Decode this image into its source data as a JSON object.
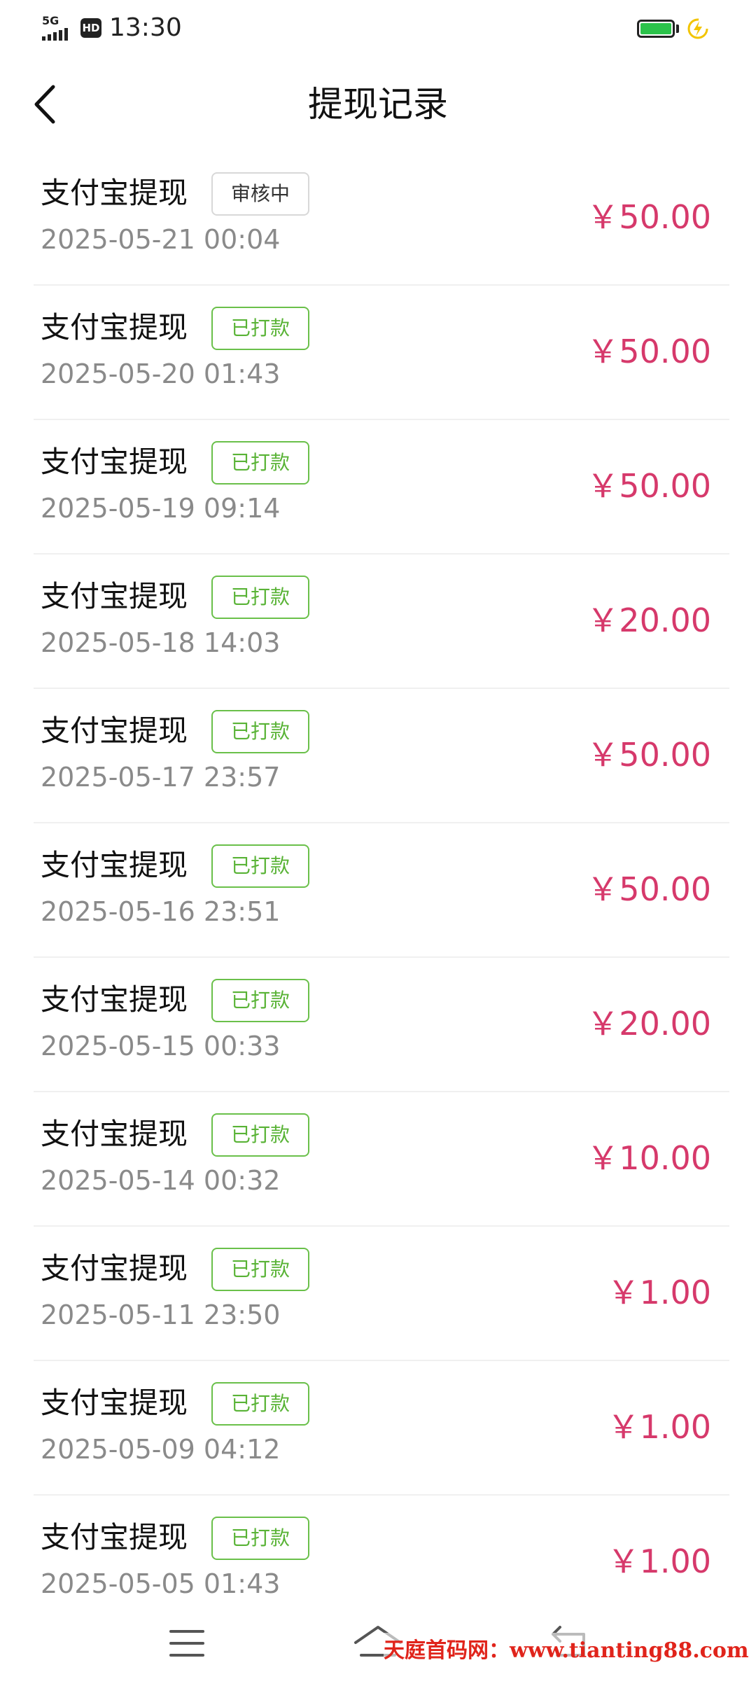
{
  "status_bar": {
    "network": "5G",
    "hd": "HD",
    "time": "13:30"
  },
  "header": {
    "title": "提现记录"
  },
  "records": [
    {
      "title": "支付宝提现",
      "status": "审核中",
      "time": "2025-05-21 00:04",
      "amount": "￥50.00"
    },
    {
      "title": "支付宝提现",
      "status": "已打款",
      "time": "2025-05-20 01:43",
      "amount": "￥50.00"
    },
    {
      "title": "支付宝提现",
      "status": "已打款",
      "time": "2025-05-19 09:14",
      "amount": "￥50.00"
    },
    {
      "title": "支付宝提现",
      "status": "已打款",
      "time": "2025-05-18 14:03",
      "amount": "￥20.00"
    },
    {
      "title": "支付宝提现",
      "status": "已打款",
      "time": "2025-05-17 23:57",
      "amount": "￥50.00"
    },
    {
      "title": "支付宝提现",
      "status": "已打款",
      "time": "2025-05-16 23:51",
      "amount": "￥50.00"
    },
    {
      "title": "支付宝提现",
      "status": "已打款",
      "time": "2025-05-15 00:33",
      "amount": "￥20.00"
    },
    {
      "title": "支付宝提现",
      "status": "已打款",
      "time": "2025-05-14 00:32",
      "amount": "￥10.00"
    },
    {
      "title": "支付宝提现",
      "status": "已打款",
      "time": "2025-05-11 23:50",
      "amount": "￥1.00"
    },
    {
      "title": "支付宝提现",
      "status": "已打款",
      "time": "2025-05-09 04:12",
      "amount": "￥1.00"
    },
    {
      "title": "支付宝提现",
      "status": "已打款",
      "time": "2025-05-05 01:43",
      "amount": "￥1.00"
    }
  ],
  "watermark": "天庭首码网：www.tianting88.com"
}
